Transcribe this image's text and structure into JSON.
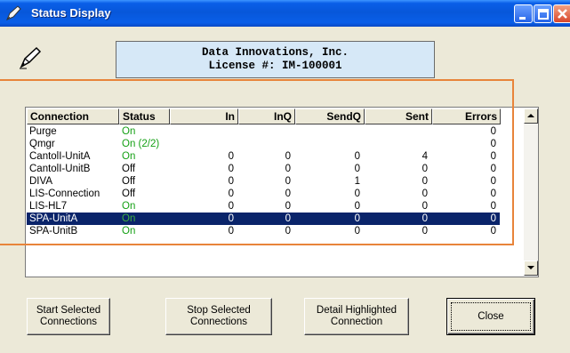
{
  "window": {
    "title": "Status Display"
  },
  "banner": {
    "line1": "Data Innovations, Inc.",
    "line2": "License #: IM-100001"
  },
  "table": {
    "columns": [
      "Connection",
      "Status",
      "In",
      "InQ",
      "SendQ",
      "Sent",
      "Errors"
    ],
    "rows": [
      {
        "connection": "Purge",
        "status": "On",
        "in": "",
        "inq": "",
        "sendq": "",
        "sent": "",
        "errors": "0",
        "selected": false
      },
      {
        "connection": "Qmgr",
        "status": "On (2/2)",
        "in": "",
        "inq": "",
        "sendq": "",
        "sent": "",
        "errors": "0",
        "selected": false
      },
      {
        "connection": "CantolI-UnitA",
        "status": "On",
        "in": "0",
        "inq": "0",
        "sendq": "0",
        "sent": "4",
        "errors": "0",
        "selected": false
      },
      {
        "connection": "CantolI-UnitB",
        "status": "Off",
        "in": "0",
        "inq": "0",
        "sendq": "0",
        "sent": "0",
        "errors": "0",
        "selected": false
      },
      {
        "connection": "DIVA",
        "status": "Off",
        "in": "0",
        "inq": "0",
        "sendq": "1",
        "sent": "0",
        "errors": "0",
        "selected": false
      },
      {
        "connection": "LIS-Connection",
        "status": "Off",
        "in": "0",
        "inq": "0",
        "sendq": "0",
        "sent": "0",
        "errors": "0",
        "selected": false
      },
      {
        "connection": "LIS-HL7",
        "status": "On",
        "in": "0",
        "inq": "0",
        "sendq": "0",
        "sent": "0",
        "errors": "0",
        "selected": false
      },
      {
        "connection": "SPA-UnitA",
        "status": "On",
        "in": "0",
        "inq": "0",
        "sendq": "0",
        "sent": "0",
        "errors": "0",
        "selected": true
      },
      {
        "connection": "SPA-UnitB",
        "status": "On",
        "in": "0",
        "inq": "0",
        "sendq": "0",
        "sent": "0",
        "errors": "0",
        "selected": false
      }
    ]
  },
  "buttons": {
    "start": "Start Selected Connections",
    "stop": "Stop Selected Connections",
    "detail": "Detail Highlighted Connection",
    "close": "Close"
  },
  "icons": {
    "app": "pen-icon",
    "logo": "pen-icon",
    "minimize": "minimize-icon",
    "maximize": "maximize-icon",
    "close": "close-icon",
    "scroll_up": "arrow-up-icon",
    "scroll_down": "arrow-down-icon"
  },
  "colors": {
    "title_bar": "#0757da",
    "banner_bg": "#d6e8f7",
    "status_on": "#16a116",
    "selection": "#0a246a",
    "highlight_annotation": "#e8843a"
  }
}
